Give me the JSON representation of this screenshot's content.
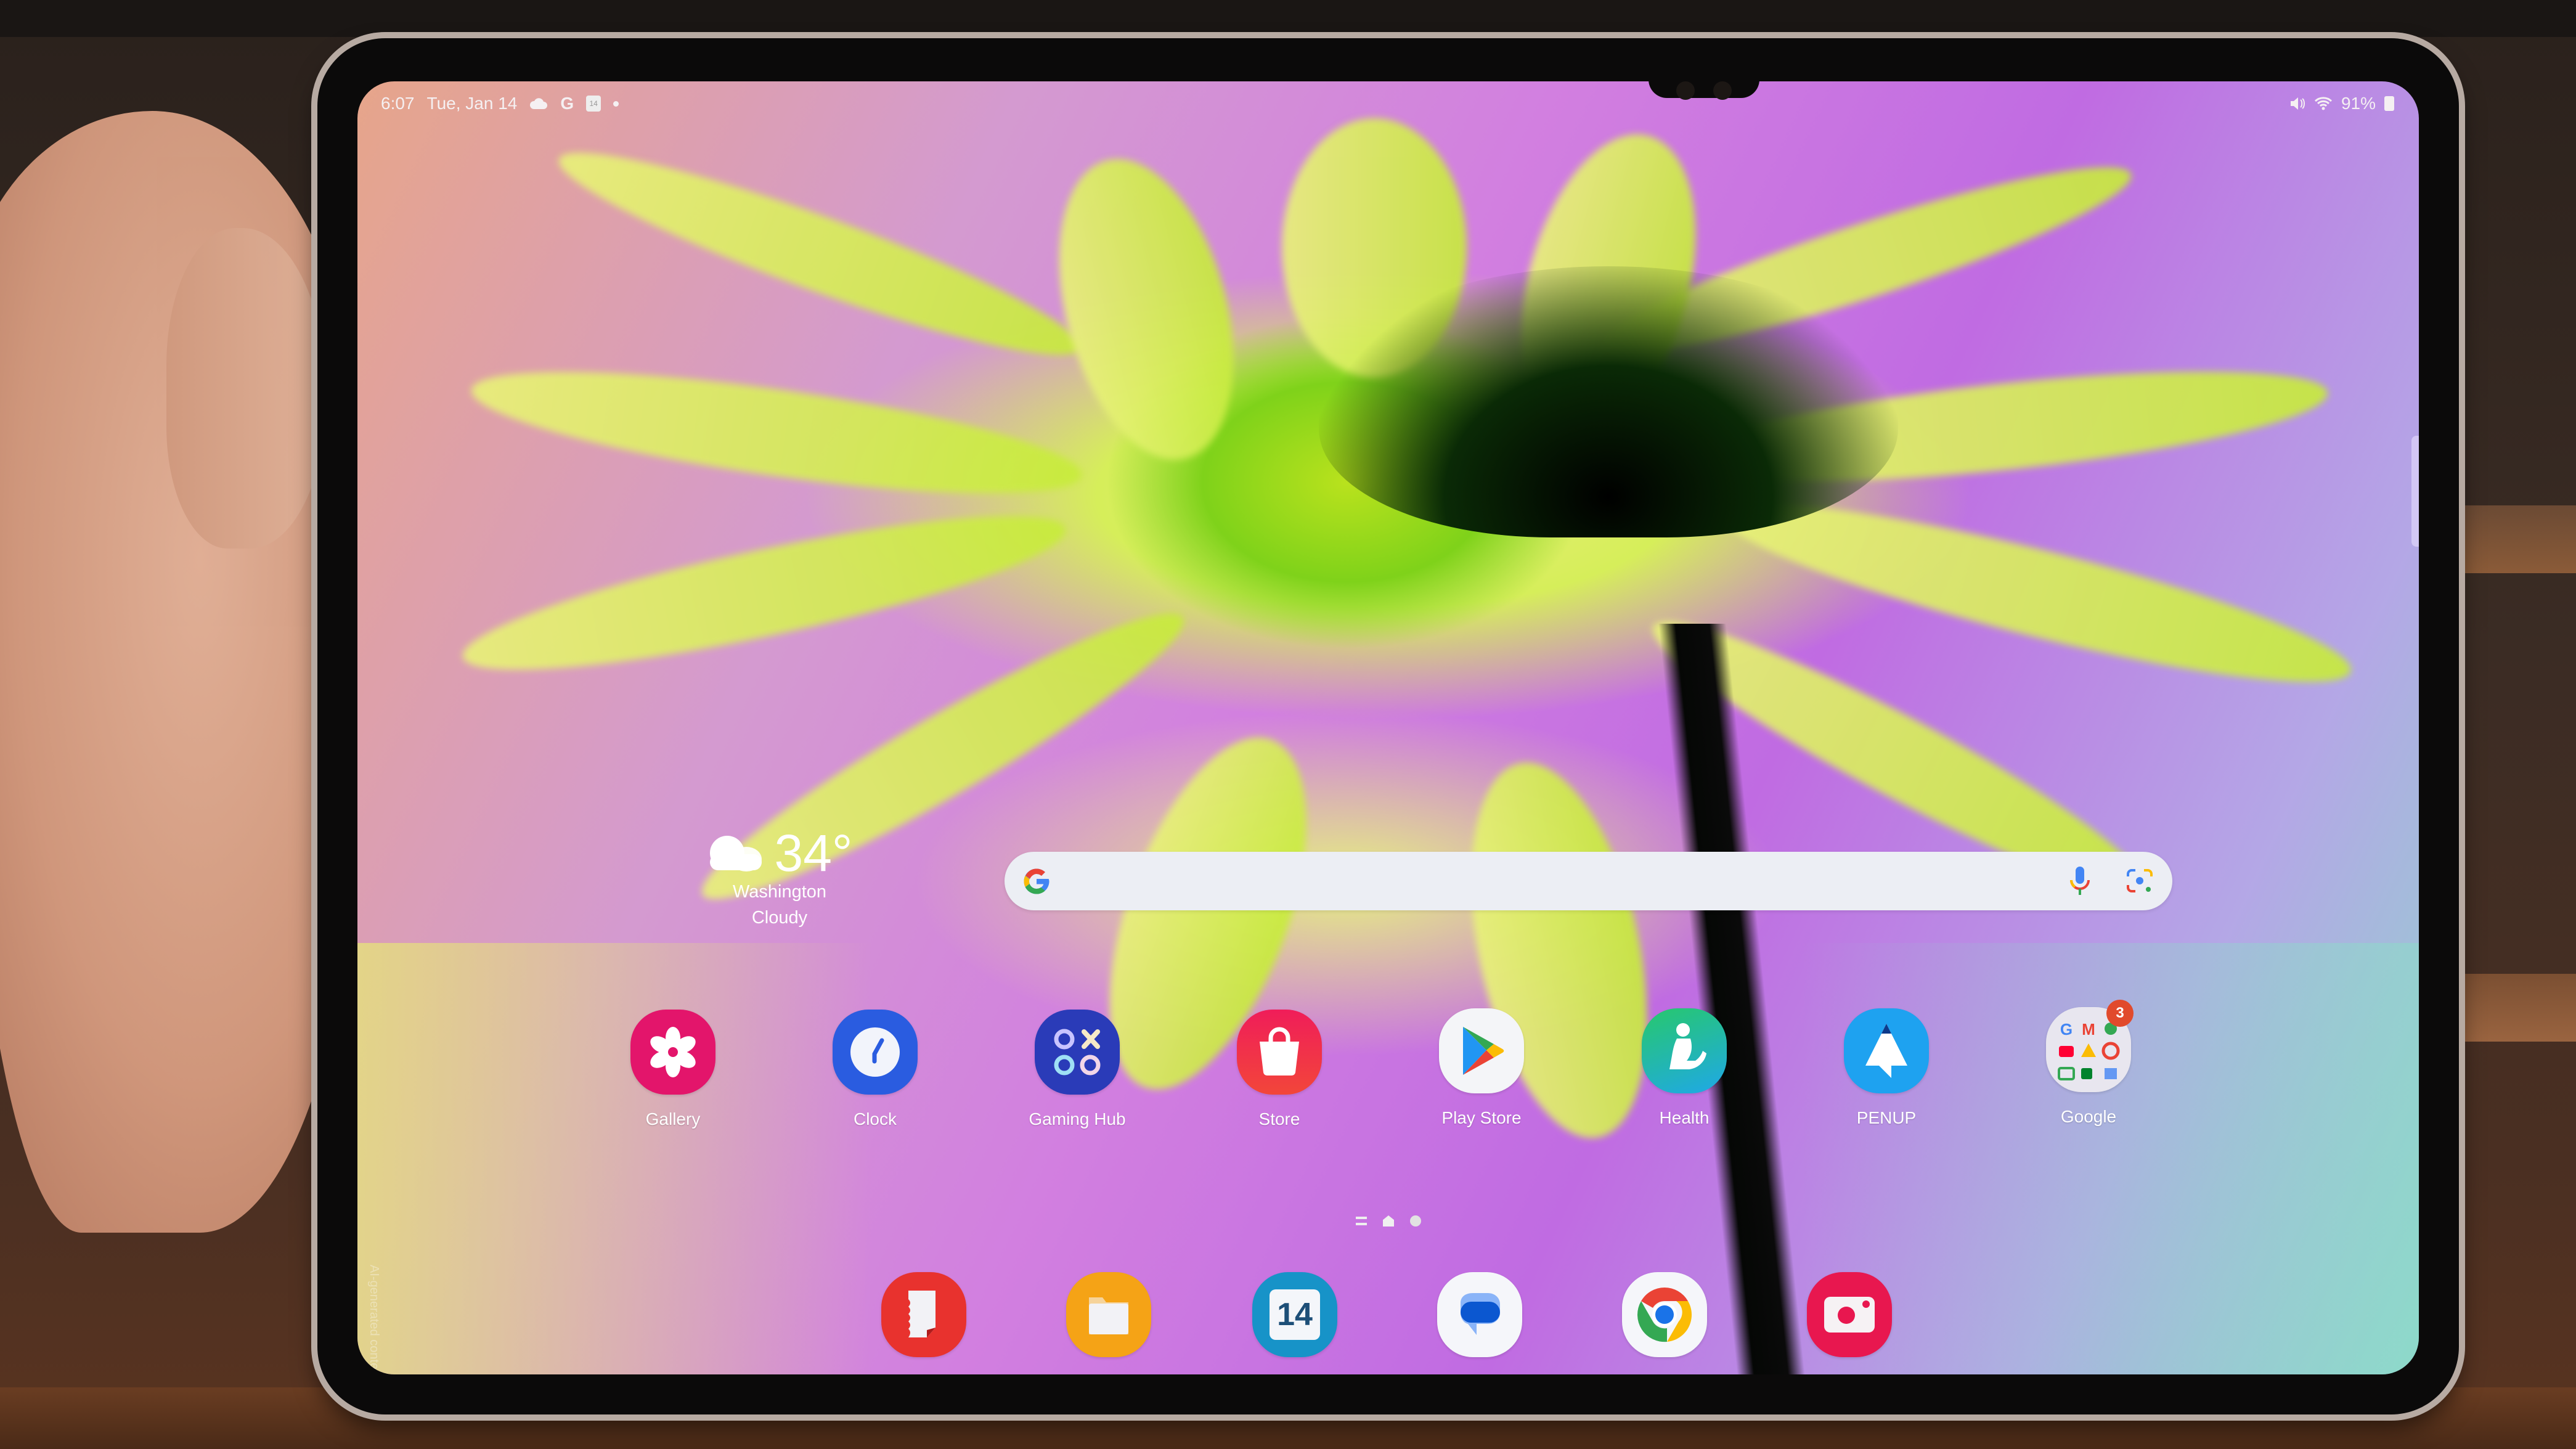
{
  "status_bar": {
    "time": "6:07",
    "date": "Tue, Jan 14",
    "notification_icons": [
      "cloud-sync-icon",
      "google-icon",
      "calendar-icon",
      "more-dot-icon"
    ],
    "calendar_day": "14",
    "google_letter": "G",
    "system_icons": [
      "mute-icon",
      "wifi-icon"
    ],
    "battery": "91%"
  },
  "watermark": "AI-generated content",
  "weather": {
    "icon": "cloudy-icon",
    "temperature": "34°",
    "location": "Washington",
    "condition": "Cloudy"
  },
  "search": {
    "logo": "G",
    "mic_icon": "mic-icon",
    "lens_icon": "lens-icon"
  },
  "apps": [
    {
      "label": "Gallery",
      "icon": "gallery-icon",
      "color": "#e3156b"
    },
    {
      "label": "Clock",
      "icon": "clock-icon",
      "color": "#2a5ce0"
    },
    {
      "label": "Gaming Hub",
      "icon": "gaming-hub-icon",
      "color": "#2a3bb8"
    },
    {
      "label": "Store",
      "icon": "store-bag-icon",
      "color": "#f0264e"
    },
    {
      "label": "Play Store",
      "icon": "play-store-icon",
      "color": "#f4f5f8"
    },
    {
      "label": "Health",
      "icon": "health-icon",
      "color": "#1fc28f"
    },
    {
      "label": "PENUP",
      "icon": "penup-icon",
      "color": "#1ea2f0"
    },
    {
      "label": "Google",
      "icon": "google-folder-icon",
      "color": "#e8e6ef",
      "badge": "3"
    }
  ],
  "pager": {
    "items": [
      "apps-list-icon",
      "home-page-icon",
      "page-dot-icon"
    ],
    "current_page": 2
  },
  "dock": [
    {
      "name": "notes-icon",
      "color": "#e8322e"
    },
    {
      "name": "files-icon",
      "color": "#f5a316"
    },
    {
      "name": "calendar-app-icon",
      "color": "#1793c8",
      "text": "14"
    },
    {
      "name": "messages-icon",
      "color": "#f5f6fa"
    },
    {
      "name": "chrome-icon",
      "color": "#f5f6fa"
    },
    {
      "name": "camera-icon",
      "color": "#e8174f"
    }
  ]
}
